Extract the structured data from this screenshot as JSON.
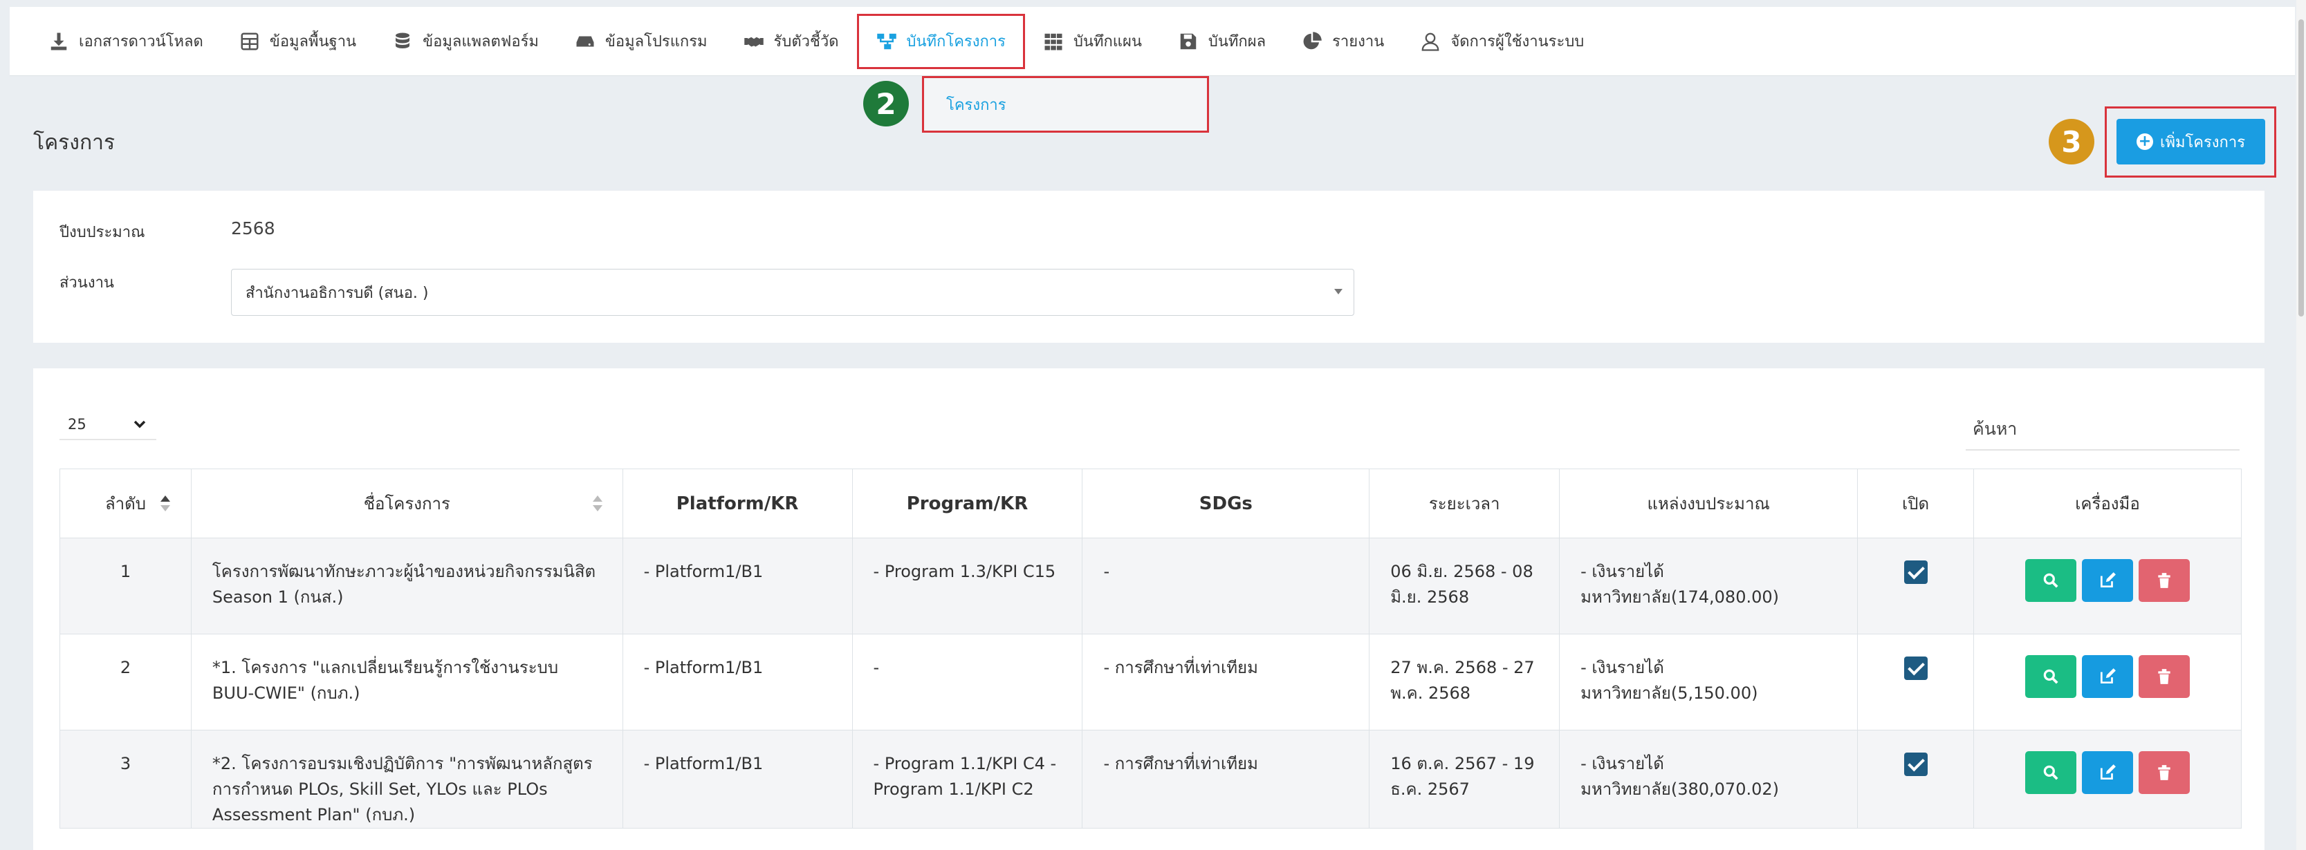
{
  "nav": {
    "items": [
      {
        "label": "เอกสารดาวน์โหลด",
        "icon": "download-icon"
      },
      {
        "label": "ข้อมูลพื้นฐาน",
        "icon": "table-icon"
      },
      {
        "label": "ข้อมูลแพลตฟอร์ม",
        "icon": "database-icon"
      },
      {
        "label": "ข้อมูลโปรแกรม",
        "icon": "hdd-icon"
      },
      {
        "label": "รับตัวชี้วัด",
        "icon": "handshake-icon"
      },
      {
        "label": "บันทึกโครงการ",
        "icon": "sitemap-icon",
        "active": true
      },
      {
        "label": "บันทึกแผน",
        "icon": "grid-icon"
      },
      {
        "label": "บันทึกผล",
        "icon": "save-icon"
      },
      {
        "label": "รายงาน",
        "icon": "pie-chart-icon"
      },
      {
        "label": "จัดการผู้ใช้งานระบบ",
        "icon": "user-icon"
      }
    ],
    "active_color": "#1aa1e0",
    "submenu": {
      "label": "โครงการ"
    }
  },
  "badges": {
    "step2": "2",
    "step3": "3"
  },
  "page": {
    "title": "โครงการ",
    "add_button": "เพิ่มโครงการ"
  },
  "filters": {
    "year_label": "ปีงบประมาณ",
    "year_value": "2568",
    "unit_label": "ส่วนงาน",
    "unit_value": "สำนักงานอธิการบดี (สนอ. )"
  },
  "table_controls": {
    "page_size": "25",
    "search_placeholder": "ค้นหา"
  },
  "table": {
    "headers": {
      "no": "ลำดับ",
      "name": "ชื่อโครงการ",
      "platform": "Platform/KR",
      "program": "Program/KR",
      "sdgs": "SDGs",
      "period": "ระยะเวลา",
      "budget": "แหล่งงบประมาณ",
      "open": "เปิด",
      "tools": "เครื่องมือ"
    },
    "rows": [
      {
        "no": "1",
        "name": "โครงการพัฒนาทักษะภาวะผู้นำของหน่วยกิจกรรมนิสิต Season 1 (กนส.)",
        "platform": "- Platform1/B1",
        "program": "- Program 1.3/KPI C15",
        "sdgs": "-",
        "period": "06 มิ.ย. 2568 - 08 มิ.ย. 2568",
        "budget": "- เงินรายได้มหาวิทยาลัย(174,080.00)",
        "open": true
      },
      {
        "no": "2",
        "name": "*1. โครงการ \"แลกเปลี่ยนเรียนรู้การใช้งานระบบ BUU-CWIE\" (กบภ.)",
        "platform": "- Platform1/B1",
        "program": "-",
        "sdgs": "- การศึกษาที่เท่าเทียม",
        "period": "27 พ.ค. 2568 - 27 พ.ค. 2568",
        "budget": "- เงินรายได้มหาวิทยาลัย(5,150.00)",
        "open": true
      },
      {
        "no": "3",
        "name": "*2. โครงการอบรมเชิงปฏิบัติการ \"การพัฒนาหลักสูตรการกำหนด PLOs, Skill Set, YLOs และ PLOs Assessment Plan\" (กบภ.)",
        "platform": "- Platform1/B1",
        "program": "- Program 1.1/KPI C4 - Program 1.1/KPI C2",
        "sdgs": "- การศึกษาที่เท่าเทียม",
        "period": "16 ต.ค. 2567 - 19 ธ.ค. 2567",
        "budget": "- เงินรายได้มหาวิทยาลัย(380,070.02)",
        "open": true
      }
    ]
  },
  "colors": {
    "view": "#1bbd84",
    "edit": "#169be0",
    "delete": "#e26470",
    "highlight": "#d9333c"
  }
}
